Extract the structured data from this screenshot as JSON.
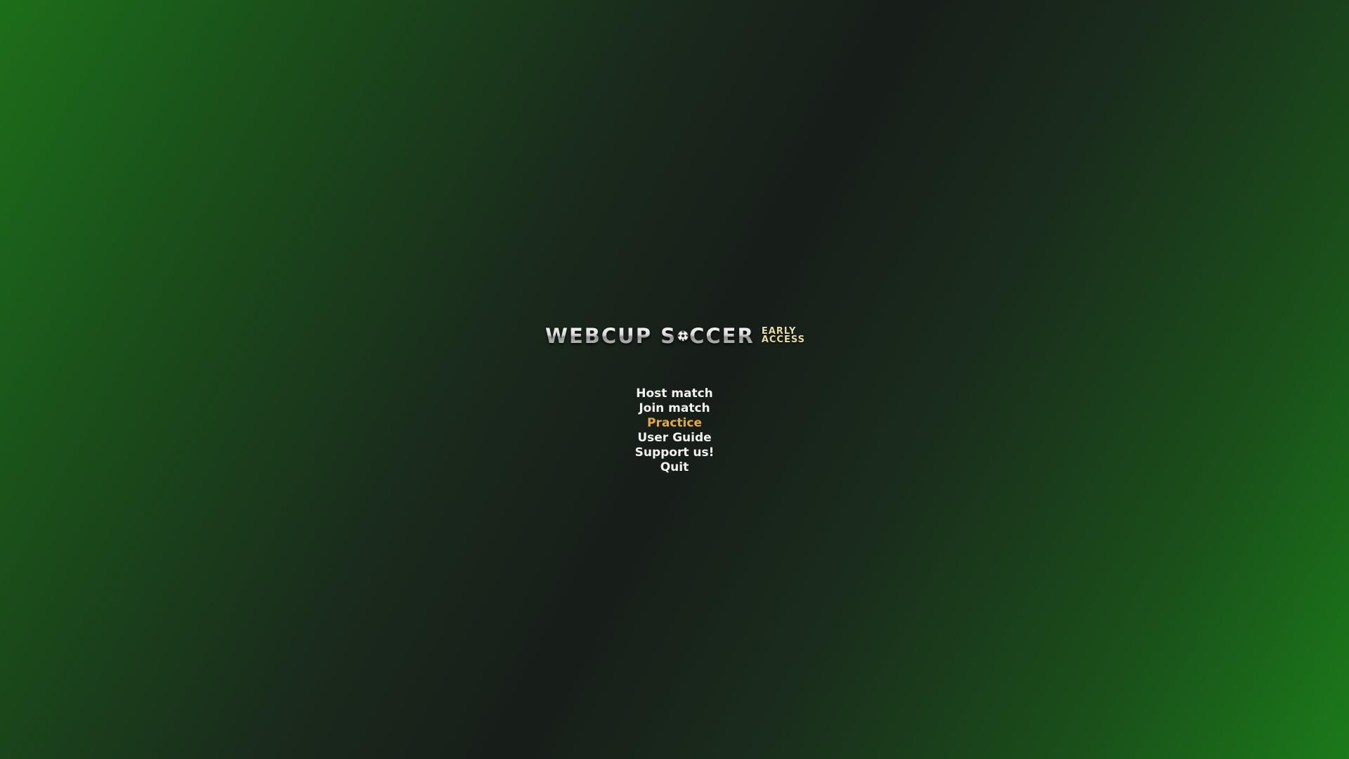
{
  "logo": {
    "part1": "WEBCUP S",
    "part2": "CCER",
    "badge_line1": "EARLY",
    "badge_line2": "ACCESS"
  },
  "menu": {
    "items": [
      {
        "label": "Host match"
      },
      {
        "label": "Join match"
      },
      {
        "label": "Practice"
      },
      {
        "label": "User Guide"
      },
      {
        "label": "Support us!"
      },
      {
        "label": "Quit"
      }
    ],
    "selected_label": "Practice"
  },
  "colors": {
    "menu_text": "#f2f2f2",
    "menu_selected": "#e8a93b",
    "badge": "#e9d9a4",
    "background_green": "#1b7a1a",
    "background_dark": "#171d19"
  }
}
